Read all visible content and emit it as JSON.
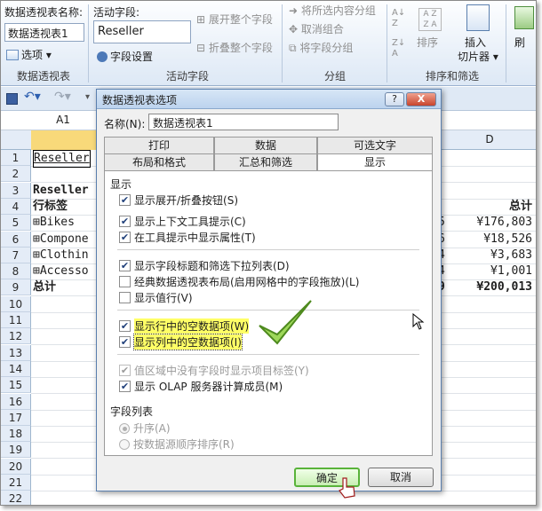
{
  "ribbon": {
    "pivot_name_label": "数据透视表名称:",
    "pivot_name_value": "数据透视表1",
    "options_label": "选项",
    "group_pivot": "数据透视表",
    "active_field_label": "活动字段:",
    "active_field_value": "Reseller",
    "field_settings": "字段设置",
    "expand_all": "展开整个字段",
    "collapse_all": "折叠整个字段",
    "group_active": "活动字段",
    "group_selection": "将所选内容分组",
    "ungroup": "取消组合",
    "group_field": "将字段分组",
    "group_group": "分组",
    "sort": "排序",
    "insert_slicer": "插入",
    "insert_slicer2": "切片器",
    "group_sort_filter": "排序和筛选",
    "refresh": "刷"
  },
  "formula": {
    "cell_ref": "A1"
  },
  "sheet": {
    "col_d": "D",
    "rows": [
      {
        "num": "1",
        "a": "Reseller",
        "d": ""
      },
      {
        "num": "2",
        "a": "",
        "d": ""
      },
      {
        "num": "3",
        "a": "Reseller",
        "d": ""
      },
      {
        "num": "4",
        "a": "行标签",
        "d": "总计"
      },
      {
        "num": "5",
        "a": "⊞Bikes",
        "c": "5",
        "d": "¥176,803"
      },
      {
        "num": "6",
        "a": "⊞Compone",
        "c": "6",
        "d": "¥18,526"
      },
      {
        "num": "7",
        "a": "⊞Clothin",
        "c": "4",
        "d": "¥3,683"
      },
      {
        "num": "8",
        "a": "⊞Accesso",
        "c": "4",
        "d": "¥1,001"
      },
      {
        "num": "9",
        "a": "总计",
        "c": "9",
        "d": "¥200,013"
      },
      {
        "num": "10"
      },
      {
        "num": "11"
      },
      {
        "num": "12"
      },
      {
        "num": "13"
      },
      {
        "num": "14"
      },
      {
        "num": "15"
      },
      {
        "num": "16"
      },
      {
        "num": "17"
      },
      {
        "num": "18"
      },
      {
        "num": "19"
      },
      {
        "num": "20"
      },
      {
        "num": "21"
      },
      {
        "num": "22"
      }
    ]
  },
  "dialog": {
    "title": "数据透视表选项",
    "help": "?",
    "close": "X",
    "name_label": "名称(N):",
    "name_value": "数据透视表1",
    "tabs_top": [
      "打印",
      "数据",
      "可选文字"
    ],
    "tabs_bottom": [
      "布局和格式",
      "汇总和筛选",
      "显示"
    ],
    "section_display": "显示",
    "options": [
      {
        "label": "显示展开/折叠按钮(S)",
        "checked": true
      },
      {
        "label": "显示上下文工具提示(C)",
        "checked": true
      },
      {
        "label": "在工具提示中显示属性(T)",
        "checked": true
      },
      {
        "label": "显示字段标题和筛选下拉列表(D)",
        "checked": true
      },
      {
        "label": "经典数据透视表布局(启用网格中的字段拖放)(L)",
        "checked": false
      },
      {
        "label": "显示值行(V)",
        "checked": false
      },
      {
        "label": "显示行中的空数据项(W)",
        "checked": true
      },
      {
        "label": "显示列中的空数据项(I)",
        "checked": true
      },
      {
        "label": "值区域中没有字段时显示项目标签(Y)",
        "checked": true
      },
      {
        "label": "显示 OLAP 服务器计算成员(M)",
        "checked": true
      }
    ],
    "section_fieldlist": "字段列表",
    "radio_asc": "升序(A)",
    "radio_source": "按数据源顺序排序(R)",
    "ok": "确定",
    "cancel": "取消"
  },
  "colors": {
    "accent": "#59b33a",
    "highlight": "#ffff66"
  }
}
